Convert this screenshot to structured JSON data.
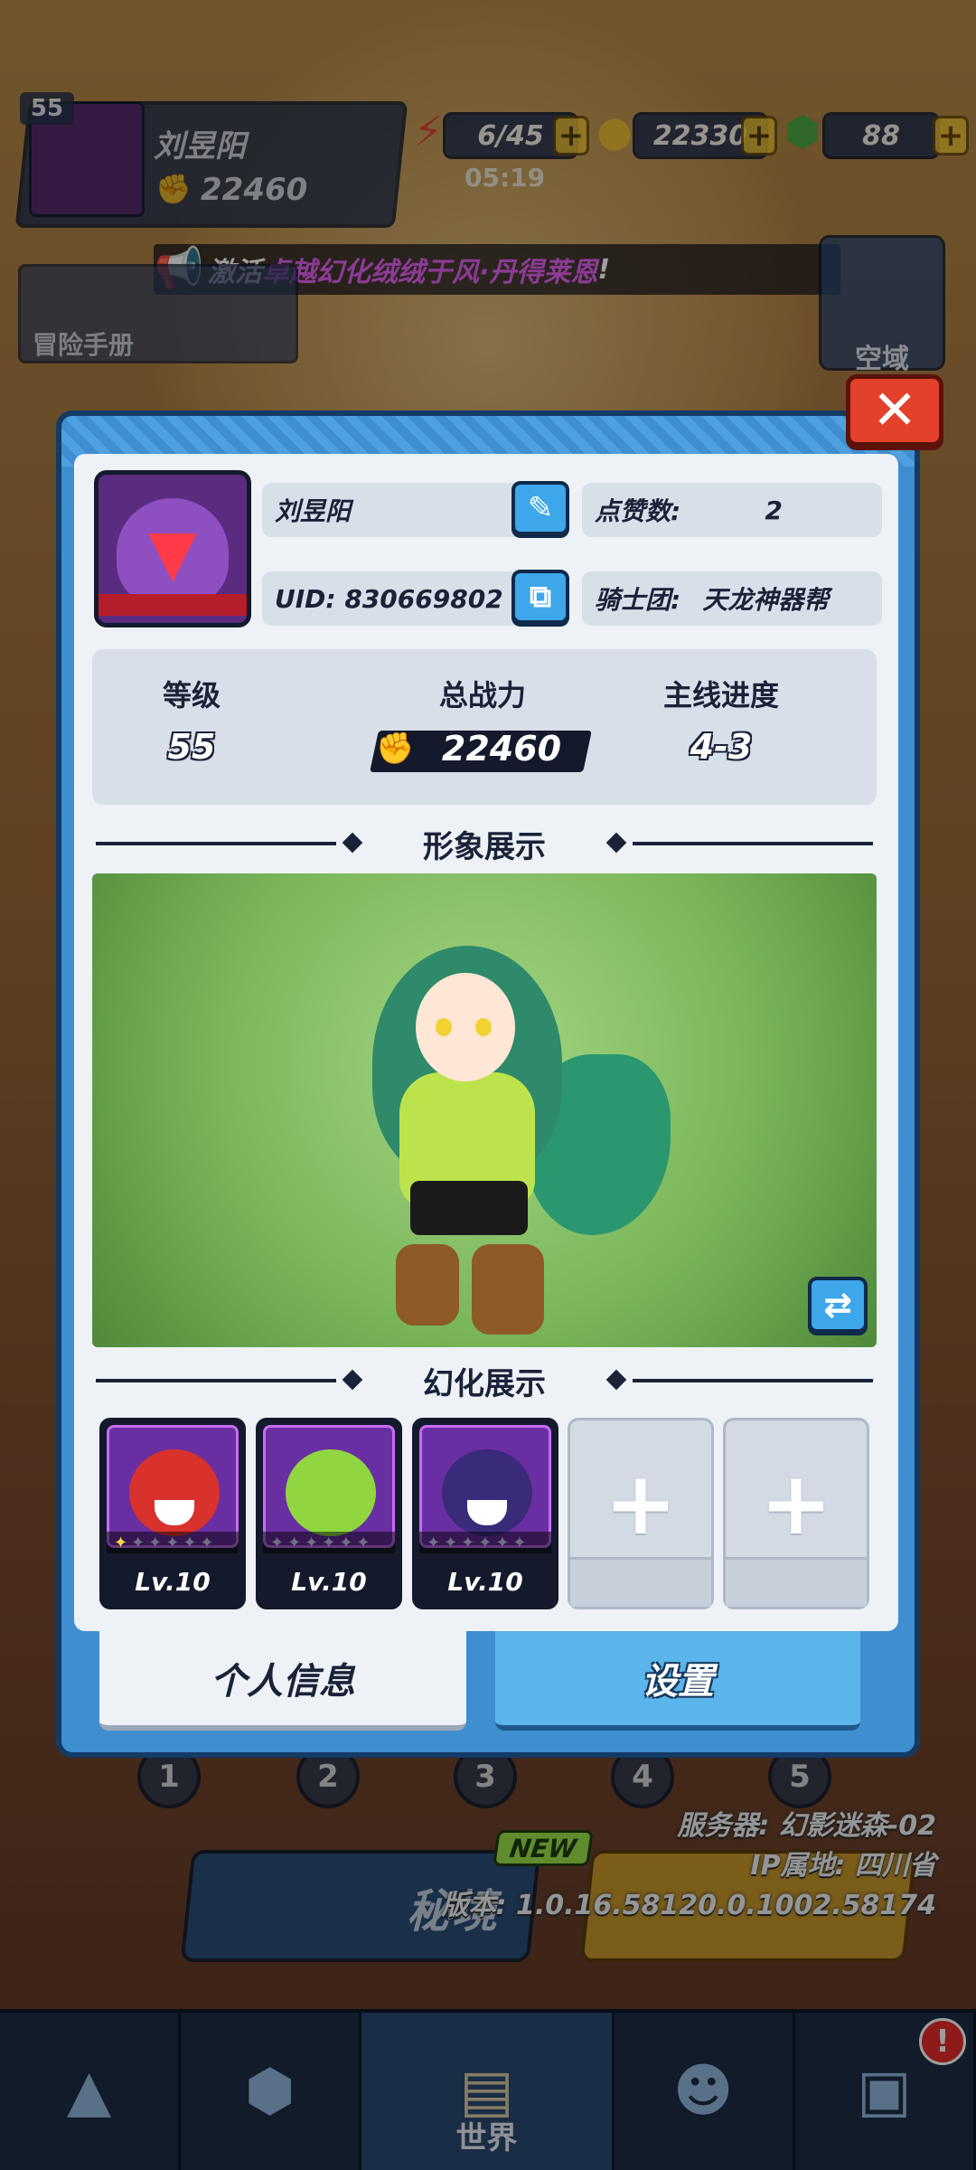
{
  "background": {
    "player_level": "55",
    "player_name": "刘昱阳",
    "player_power": "22460",
    "energy": "6/45",
    "energy_timer": "05:19",
    "gold": "22330",
    "gems": "88",
    "announcement_prefix": "激活",
    "announcement_highlight": "卓越幻化绒绒于风·丹得莱恩",
    "announcement_suffix": "!",
    "adventure_book_label": "冒险手册",
    "airspace_label": "空域",
    "stage_numbers": [
      "1",
      "2",
      "3",
      "4",
      "5"
    ],
    "secret_realm_label": "秘境",
    "new_tag": "NEW",
    "server_info": {
      "server": "服务器: 幻影迷森-02",
      "ip_location": "IP属地: 四川省",
      "version": "版本: 1.0.16.58120.0.1002.58174"
    },
    "bottom_nav": {
      "world_label": "世界",
      "alert_badge": "!"
    }
  },
  "profile": {
    "name": "刘昱阳",
    "likes_label": "点赞数:",
    "likes_value": "2",
    "uid_text": "UID: 830669802",
    "guild_label": "骑士团:",
    "guild_value": "天龙神器帮",
    "stats": {
      "level_label": "等级",
      "level_value": "55",
      "power_label": "总战力",
      "power_value": "22460",
      "progress_label": "主线进度",
      "progress_value": "4-3"
    },
    "appearance_title": "形象展示",
    "transform_title": "幻化展示",
    "pets": [
      {
        "level": "Lv.10",
        "color": "#d9322c",
        "stars_lit": 1
      },
      {
        "level": "Lv.10",
        "color": "#8fd640",
        "stars_lit": 0
      },
      {
        "level": "Lv.10",
        "color": "#3a2a7a",
        "stars_lit": 0
      }
    ],
    "empty_slot_symbol": "+",
    "tabs": {
      "info": "个人信息",
      "settings": "设置"
    }
  },
  "icons": {
    "close": "✕",
    "edit": "✎",
    "copy": "⧉",
    "swap": "⇄",
    "power": "✊",
    "megaphone": "📢"
  }
}
